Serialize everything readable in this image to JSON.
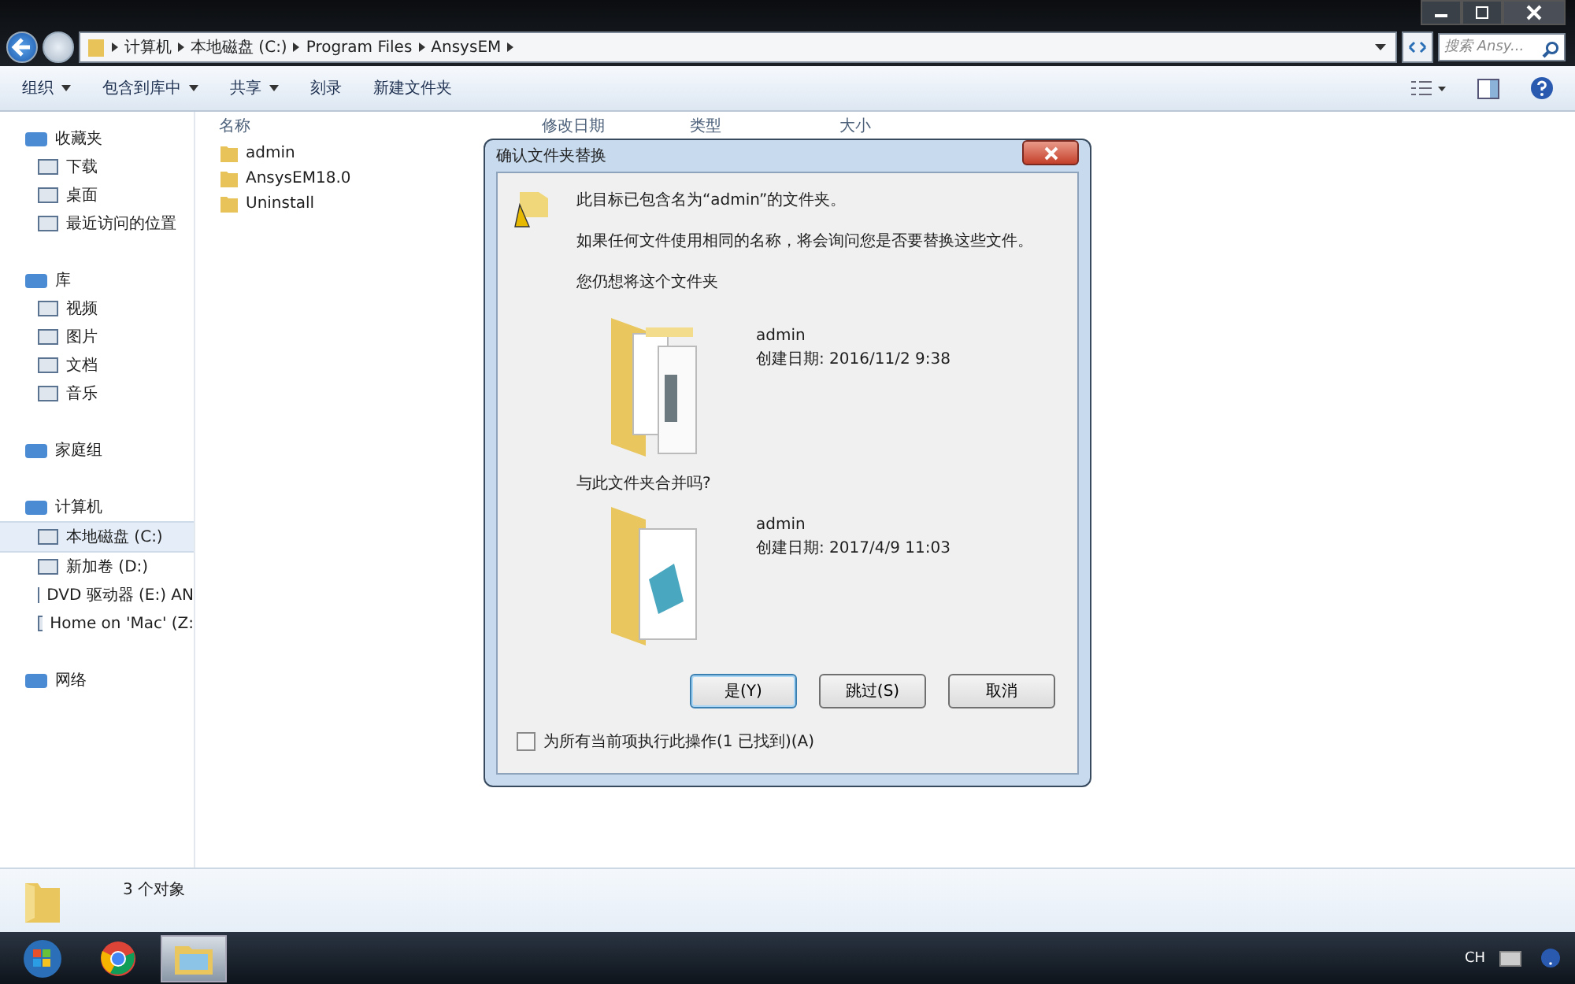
{
  "address_bar": {
    "crumbs": [
      "计算机",
      "本地磁盘 (C:)",
      "Program Files",
      "AnsysEM"
    ]
  },
  "search": {
    "placeholder": "搜索 Ansy..."
  },
  "toolbar": {
    "items": [
      {
        "label": "组织",
        "dropdown": true
      },
      {
        "label": "包含到库中",
        "dropdown": true
      },
      {
        "label": "共享",
        "dropdown": true
      },
      {
        "label": "刻录",
        "dropdown": false
      },
      {
        "label": "新建文件夹",
        "dropdown": false
      }
    ]
  },
  "sidebar": {
    "groups": [
      {
        "label": "收藏夹",
        "children": [
          {
            "label": "下载",
            "selected": false
          },
          {
            "label": "桌面",
            "selected": false
          },
          {
            "label": "最近访问的位置",
            "selected": false
          }
        ]
      },
      {
        "label": "库",
        "children": [
          {
            "label": "视频",
            "selected": false
          },
          {
            "label": "图片",
            "selected": false
          },
          {
            "label": "文档",
            "selected": false
          },
          {
            "label": "音乐",
            "selected": false
          }
        ]
      },
      {
        "label": "家庭组"
      },
      {
        "label": "计算机",
        "children": [
          {
            "label": "本地磁盘 (C:)",
            "selected": true
          },
          {
            "label": "新加卷 (D:)",
            "selected": false
          },
          {
            "label": "DVD 驱动器 (E:) AN",
            "selected": false
          },
          {
            "label": "Home on 'Mac' (Z:",
            "selected": false
          }
        ]
      },
      {
        "label": "网络"
      }
    ]
  },
  "table": {
    "columns": [
      "名称",
      "修改日期",
      "类型",
      "大小"
    ],
    "rows": [
      "admin",
      "AnsysEM18.0",
      "Uninstall"
    ]
  },
  "dialog": {
    "title": "确认文件夹替换",
    "message": "此目标已包含名为“admin”的文件夹。",
    "note": "如果任何文件使用相同的名称，将会询问您是否要替换这些文件。",
    "prompt": "您仍想将这个文件夹",
    "existing": {
      "name": "admin",
      "date": "创建日期: 2016/11/2 9:38"
    },
    "question": "与此文件夹合并吗?",
    "incoming": {
      "name": "admin",
      "date": "创建日期: 2017/4/9 11:03"
    },
    "buttons": [
      {
        "label": "是(Y)",
        "default": true
      },
      {
        "label": "跳过(S)",
        "default": false
      },
      {
        "label": "取消",
        "default": false
      }
    ],
    "checkbox": {
      "label": "为所有当前项执行此操作(1 已找到)(A)",
      "checked": false
    }
  },
  "status_bar": {
    "count": "3 个对象"
  },
  "taskbar": {
    "items": [
      {
        "kind": "start",
        "selected": false
      },
      {
        "kind": "browser",
        "selected": false
      },
      {
        "kind": "explorer",
        "selected": true
      }
    ],
    "tray": "CH"
  }
}
